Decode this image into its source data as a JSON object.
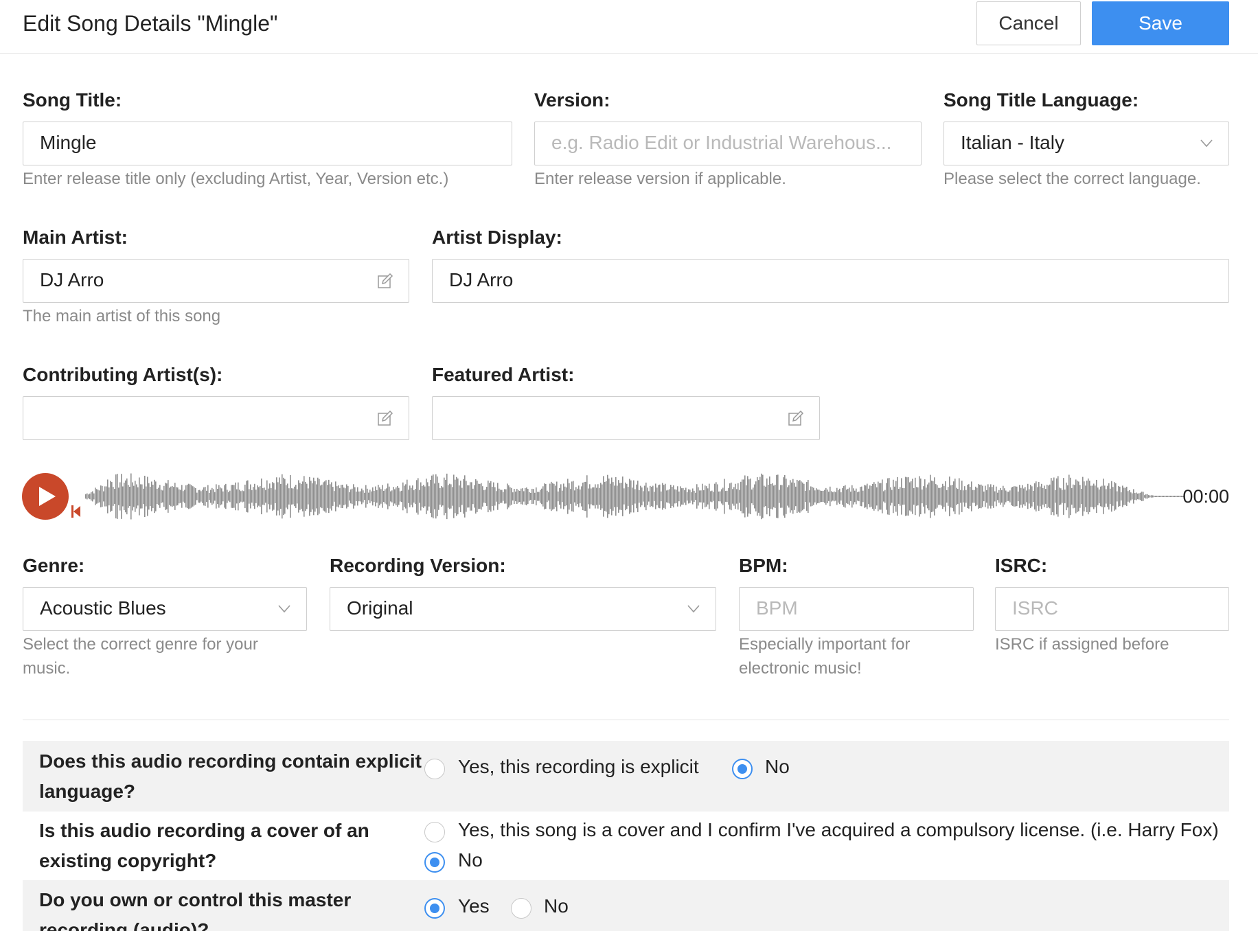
{
  "header": {
    "title": "Edit Song Details \"Mingle\"",
    "cancel_label": "Cancel",
    "save_label": "Save"
  },
  "song_title": {
    "label": "Song Title:",
    "value": "Mingle",
    "help": "Enter release title only (excluding Artist, Year, Version etc.)"
  },
  "version": {
    "label": "Version:",
    "placeholder": "e.g. Radio Edit or Industrial Warehous...",
    "help": "Enter release version if applicable."
  },
  "title_language": {
    "label": "Song Title Language:",
    "value": "Italian - Italy",
    "help": "Please select the correct language."
  },
  "main_artist": {
    "label": "Main Artist:",
    "value": "DJ Arro",
    "help": "The main artist of this song"
  },
  "artist_display": {
    "label": "Artist Display:",
    "value": "DJ Arro"
  },
  "contributing_artist": {
    "label": "Contributing Artist(s):",
    "value": ""
  },
  "featured_artist": {
    "label": "Featured Artist:",
    "value": ""
  },
  "player": {
    "time": "00:00",
    "progress": 0
  },
  "genre": {
    "label": "Genre:",
    "value": "Acoustic Blues",
    "help": "Select the correct genre for your music."
  },
  "recording_version": {
    "label": "Recording Version:",
    "value": "Original"
  },
  "bpm": {
    "label": "BPM:",
    "placeholder": "BPM",
    "help": "Especially important for electronic music!"
  },
  "isrc": {
    "label": "ISRC:",
    "placeholder": "ISRC",
    "help": "ISRC if assigned before"
  },
  "questions": [
    {
      "text": "Does this audio recording contain explicit language?",
      "options": [
        "Yes, this recording is explicit",
        "No"
      ],
      "selected": "No"
    },
    {
      "text": "Is this audio recording a cover of an existing copyright?",
      "options": [
        "Yes, this song is a cover and I confirm I've acquired a compulsory license. (i.e. Harry Fox)",
        "No"
      ],
      "selected": "No"
    },
    {
      "text": "Do you own or control this master recording (audio)?",
      "options": [
        "Yes",
        "No"
      ],
      "selected": "Yes"
    }
  ],
  "colors": {
    "accent": "#3d8ff0",
    "play": "#c9482a",
    "waveform": "#8f8f8f"
  },
  "icons": {
    "dropdown": "chevron-down-icon",
    "edit": "edit-icon",
    "play": "play-icon"
  }
}
